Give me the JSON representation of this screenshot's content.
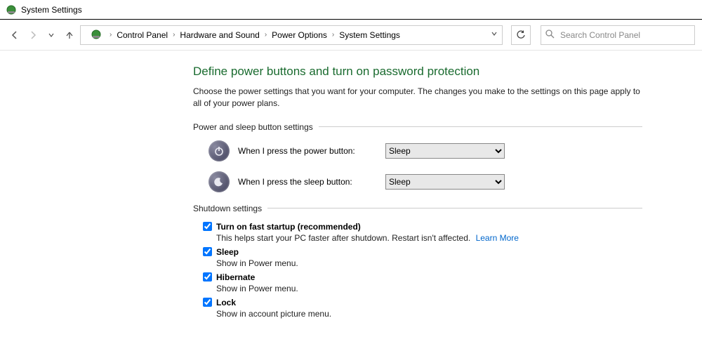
{
  "window": {
    "title": "System Settings"
  },
  "breadcrumbs": {
    "items": [
      "Control Panel",
      "Hardware and Sound",
      "Power Options",
      "System Settings"
    ]
  },
  "search": {
    "placeholder": "Search Control Panel"
  },
  "page": {
    "title": "Define power buttons and turn on password protection",
    "description": "Choose the power settings that you want for your computer. The changes you make to the settings on this page apply to all of your power plans."
  },
  "group1": {
    "title": "Power and sleep button settings",
    "power_label": "When I press the power button:",
    "power_value": "Sleep",
    "sleep_label": "When I press the sleep button:",
    "sleep_value": "Sleep"
  },
  "group2": {
    "title": "Shutdown settings",
    "items": [
      {
        "label": "Turn on fast startup (recommended)",
        "sub": "This helps start your PC faster after shutdown. Restart isn't affected.",
        "link": "Learn More",
        "checked": true
      },
      {
        "label": "Sleep",
        "sub": "Show in Power menu.",
        "checked": true
      },
      {
        "label": "Hibernate",
        "sub": "Show in Power menu.",
        "checked": true
      },
      {
        "label": "Lock",
        "sub": "Show in account picture menu.",
        "checked": true
      }
    ]
  }
}
